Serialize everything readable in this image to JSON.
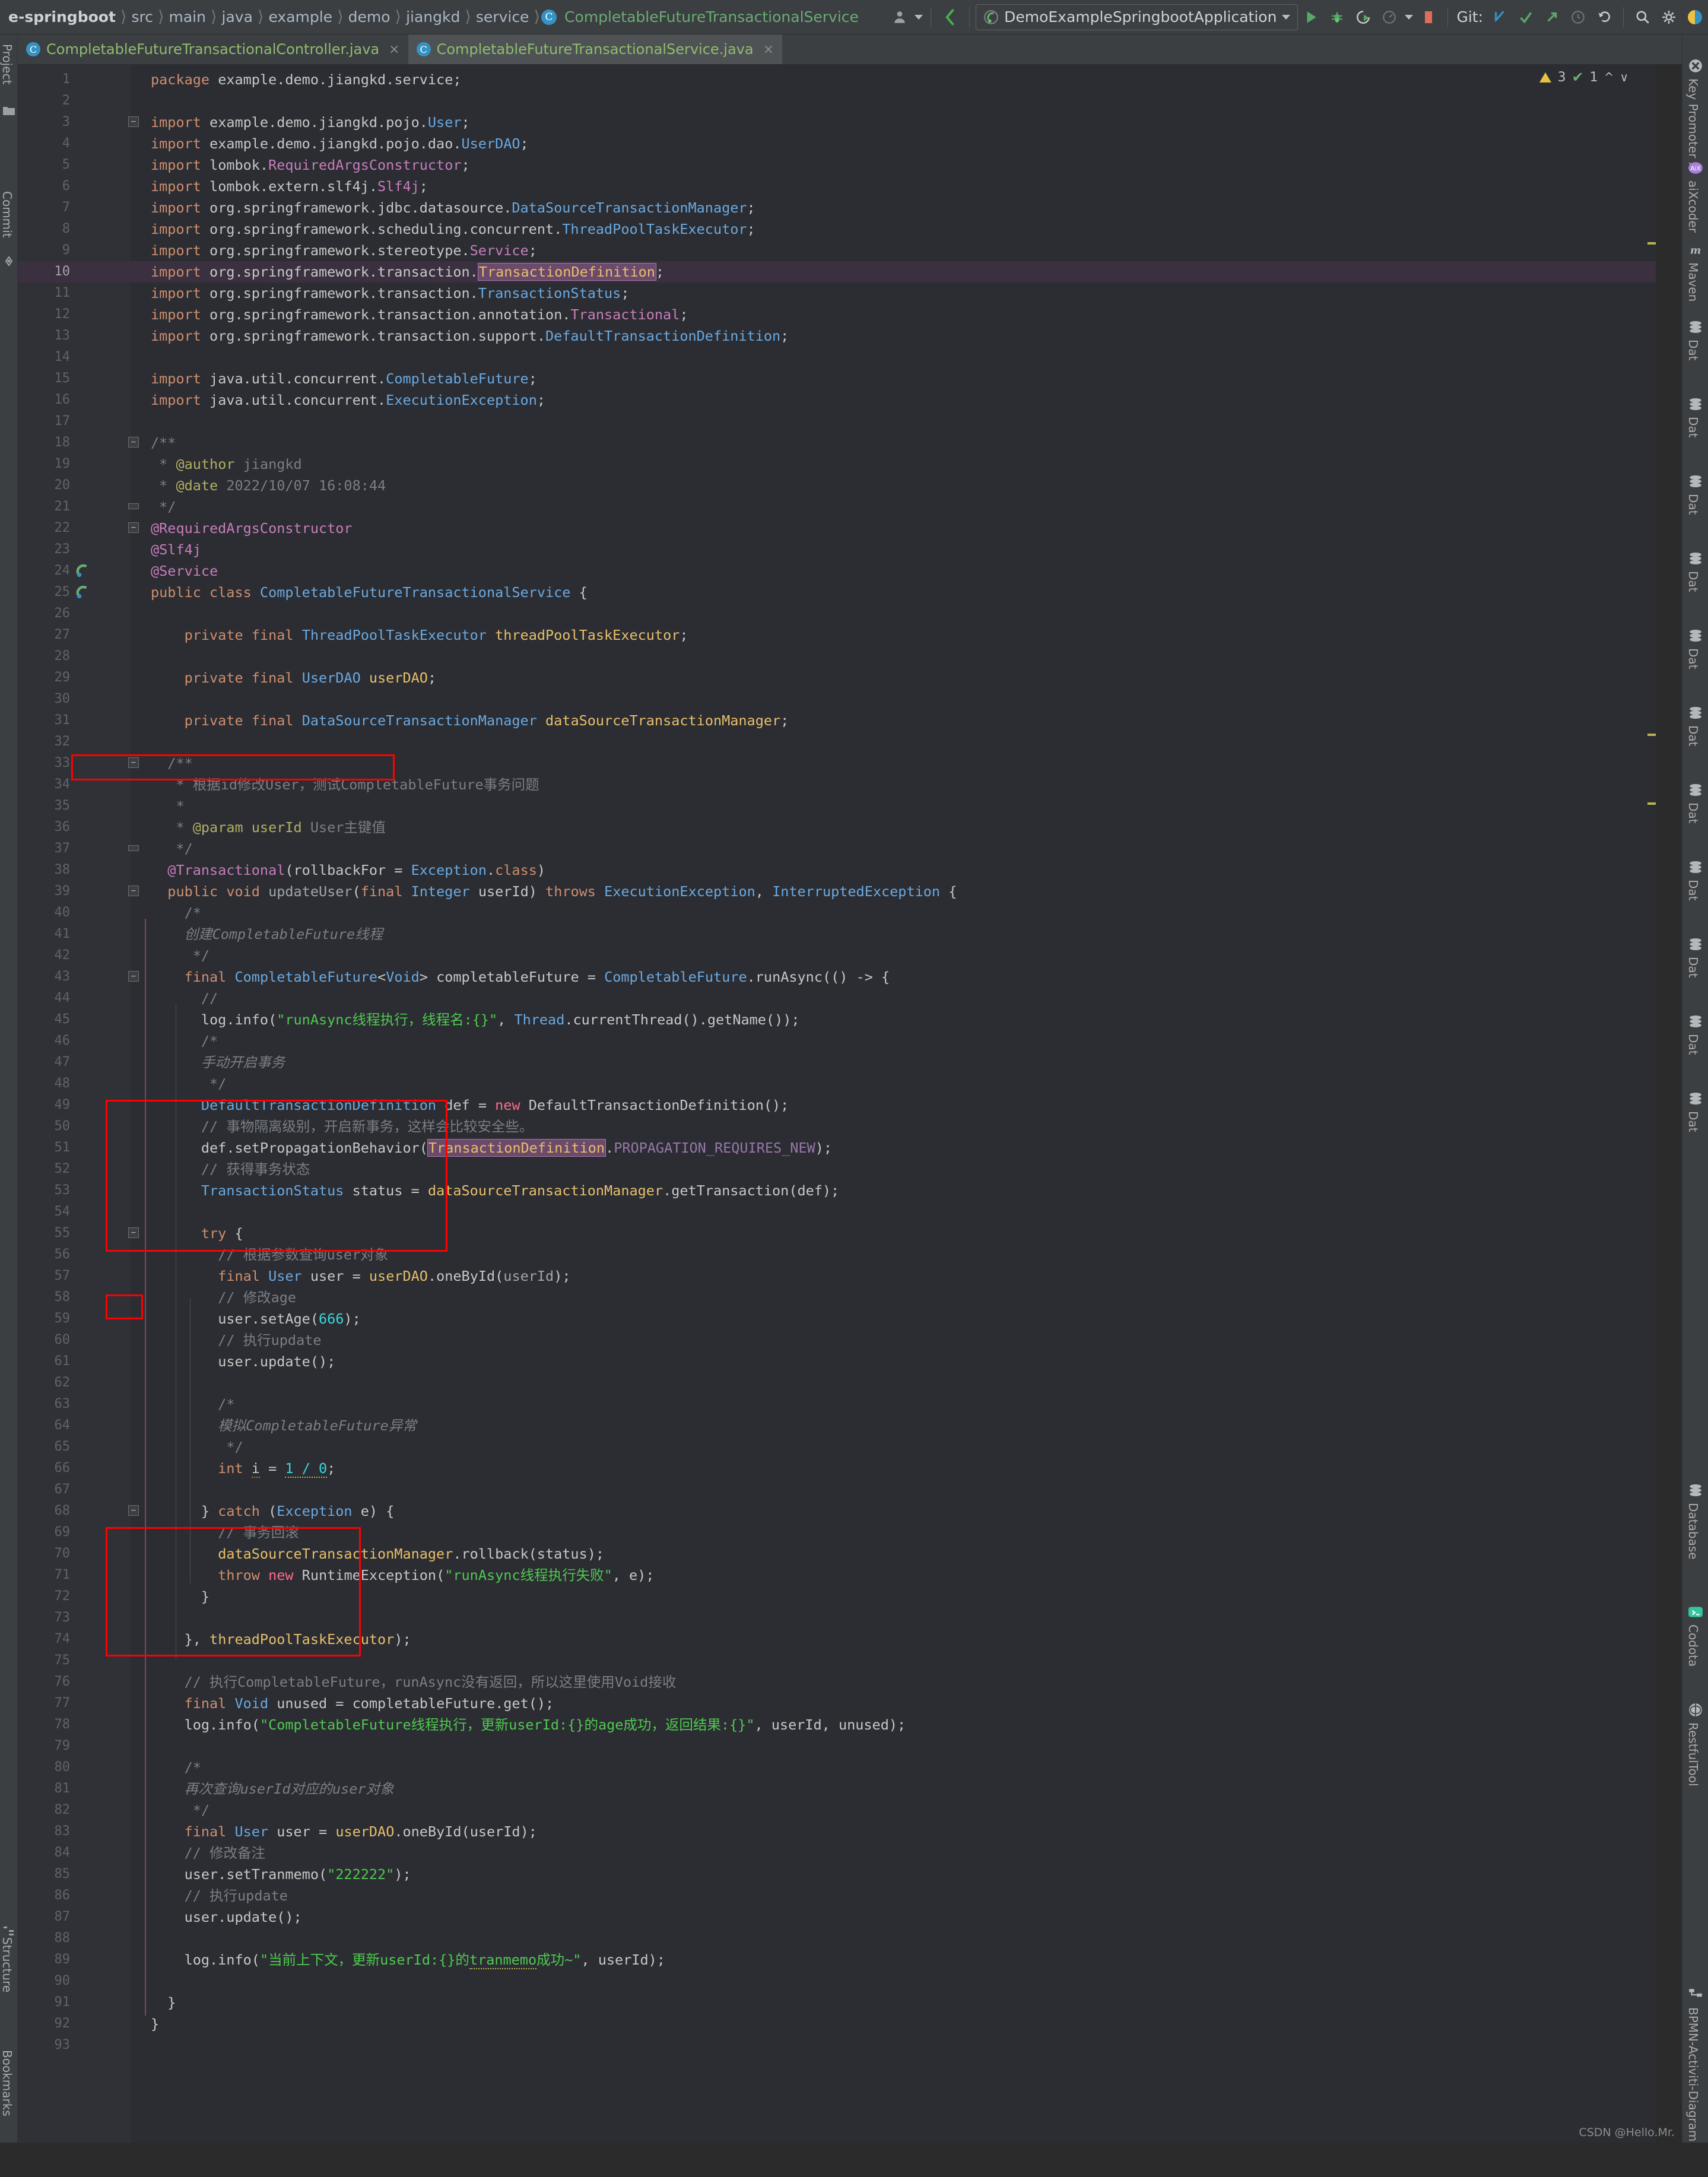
{
  "breadcrumb": {
    "items": [
      "e-springboot",
      "src",
      "main",
      "java",
      "example",
      "demo",
      "jiangkd",
      "service"
    ],
    "class_name": "CompletableFutureTransactionalService",
    "class_icon": "C"
  },
  "toolbar": {
    "avatar_icon": "user-icon",
    "back_icon": "back-arrow-icon",
    "run_config_name": "DemoExampleSpringbootApplication",
    "run_icon": "run-icon",
    "debug_icon": "debug-icon",
    "run_coverage_icon": "run-with-coverage-icon",
    "profile_icon": "profiler-icon",
    "stop_icon": "stop-icon",
    "git_label": "Git:",
    "git_update_icon": "update-project-icon",
    "git_commit_icon": "commit-icon",
    "git_push_icon": "push-icon",
    "git_history_icon": "history-icon",
    "git_rollback_icon": "rollback-icon",
    "search_icon": "search-everywhere-icon",
    "settings_icon": "gear-icon",
    "plugin_icon": "ide-plugin-icon"
  },
  "tabs": [
    {
      "label": "CompletableFutureTransactionalController.java",
      "icon": "C",
      "active": false,
      "close": "×"
    },
    {
      "label": "CompletableFutureTransactionalService.java",
      "icon": "C",
      "active": true,
      "close": "×"
    }
  ],
  "left_rail": [
    {
      "label": "Project",
      "icon": "project-icon"
    },
    {
      "label": "Commit",
      "icon": "commit-icon"
    },
    {
      "label": "Structure",
      "icon": "structure-icon"
    },
    {
      "label": "Bookmarks",
      "icon": "bookmarks-icon"
    }
  ],
  "right_rail": [
    {
      "label": "Key Promoter X",
      "icon": "key-promoter-icon"
    },
    {
      "label": "aiXcoder",
      "icon": "aixcoder-icon"
    },
    {
      "label": "Maven",
      "icon": "maven-icon"
    },
    {
      "label": "Dat",
      "icon": "database-icon"
    },
    {
      "label": "Dat",
      "icon": "database-icon"
    },
    {
      "label": "Dat",
      "icon": "database-icon"
    },
    {
      "label": "Dat",
      "icon": "database-icon"
    },
    {
      "label": "Dat",
      "icon": "database-icon"
    },
    {
      "label": "Dat",
      "icon": "database-icon"
    },
    {
      "label": "Dat",
      "icon": "database-icon"
    },
    {
      "label": "Dat",
      "icon": "database-icon"
    },
    {
      "label": "Dat",
      "icon": "database-icon"
    },
    {
      "label": "Dat",
      "icon": "database-icon"
    },
    {
      "label": "Dat",
      "icon": "database-icon"
    },
    {
      "label": "Database",
      "icon": "database-icon"
    },
    {
      "label": "Codota",
      "icon": "codota-icon"
    },
    {
      "label": "RestfulTool",
      "icon": "restfultool-icon"
    },
    {
      "label": "BPMN-Activiti-Diagram",
      "icon": "bpmn-icon"
    }
  ],
  "inspections": {
    "warning_count": "3",
    "weak_warning_count": "1",
    "warning_icon": "warning-triangle-icon",
    "weak_warning_icon": "weak-warning-icon",
    "up_icon": "chevron-up-icon",
    "down_icon": "chevron-down-icon",
    "more_icon": "more-vertical-icon"
  },
  "watermark": "CSDN @Hello.Mr.",
  "editor": {
    "file": "CompletableFutureTransactionalService.java",
    "total_lines": 93,
    "highlighted_line": 10,
    "highlighted_token": "TransactionDefinition",
    "lines": [
      {
        "n": 1,
        "html": "<span class='kw'>package</span> <span class='pln'>example.demo.jiangkd.service;</span>"
      },
      {
        "n": 2,
        "html": ""
      },
      {
        "n": 3,
        "html": "<span class='kw'>import</span> <span class='pln'>example.demo.jiangkd.pojo.</span><span class='typ'>User</span><span class='pln'>;</span>",
        "fold": "minus"
      },
      {
        "n": 4,
        "html": "<span class='kw'>import</span> <span class='pln'>example.demo.jiangkd.pojo.dao.</span><span class='typ'>UserDAO</span><span class='pln'>;</span>"
      },
      {
        "n": 5,
        "html": "<span class='kw'>import</span> <span class='pln'>lombok.</span><span class='annp'>RequiredArgsConstructor</span><span class='pln'>;</span>"
      },
      {
        "n": 6,
        "html": "<span class='kw'>import</span> <span class='pln'>lombok.extern.slf4j.</span><span class='annp'>Slf4j</span><span class='pln'>;</span>"
      },
      {
        "n": 7,
        "html": "<span class='kw'>import</span> <span class='pln'>org.springframework.jdbc.datasource.</span><span class='typ'>DataSourceTransactionManager</span><span class='pln'>;</span>"
      },
      {
        "n": 8,
        "html": "<span class='kw'>import</span> <span class='pln'>org.springframework.scheduling.concurrent.</span><span class='typ'>ThreadPoolTaskExecutor</span><span class='pln'>;</span>"
      },
      {
        "n": 9,
        "html": "<span class='kw'>import</span> <span class='pln'>org.springframework.stereotype.</span><span class='annp'>Service</span><span class='pln'>;</span>"
      },
      {
        "n": 10,
        "html": "<span class='kw'>import</span> <span class='pln'>org.springframework.transaction.</span><span class='hlid'>TransactionDefinition</span><span class='pln'>;</span>",
        "hl": true
      },
      {
        "n": 11,
        "html": "<span class='kw'>import</span> <span class='pln'>org.springframework.transaction.</span><span class='typ'>TransactionStatus</span><span class='pln'>;</span>"
      },
      {
        "n": 12,
        "html": "<span class='kw'>import</span> <span class='pln'>org.springframework.transaction.annotation.</span><span class='annp'>Transactional</span><span class='pln'>;</span>"
      },
      {
        "n": 13,
        "html": "<span class='kw'>import</span> <span class='pln'>org.springframework.transaction.support.</span><span class='typ'>DefaultTransactionDefinition</span><span class='pln'>;</span>"
      },
      {
        "n": 14,
        "html": ""
      },
      {
        "n": 15,
        "html": "<span class='kw'>import</span> <span class='pln'>java.util.concurrent.</span><span class='typ'>CompletableFuture</span><span class='pln'>;</span>"
      },
      {
        "n": 16,
        "html": "<span class='kw'>import</span> <span class='pln'>java.util.concurrent.</span><span class='typ'>ExecutionException</span><span class='pln'>;</span>"
      },
      {
        "n": 17,
        "html": ""
      },
      {
        "n": 18,
        "html": "<span class='cmt'>/**</span>",
        "fold": "minus"
      },
      {
        "n": 19,
        "html": " <span class='cmt'>* </span><span class='ann'>@author</span><span class='cmt'> jiangkd</span>"
      },
      {
        "n": 20,
        "html": " <span class='cmt'>* </span><span class='ann'>@date</span><span class='cmt'> 2022/10/07 16:08:44</span>"
      },
      {
        "n": 21,
        "html": " <span class='cmt'>*/</span>",
        "fold": "end"
      },
      {
        "n": 22,
        "html": "<span class='annp'>@RequiredArgsConstructor</span>",
        "fold": "minus"
      },
      {
        "n": 23,
        "html": "<span class='annp'>@Slf4j</span>"
      },
      {
        "n": 24,
        "html": "<span class='annp'>@Service</span>",
        "gutter": "spring-bean-icon"
      },
      {
        "n": 25,
        "html": "<span class='kw'>public class</span> <span class='typ'>CompletableFutureTransactionalService</span> <span class='pln'>{</span>",
        "gutter": "spring-bean-icon2"
      },
      {
        "n": 26,
        "html": ""
      },
      {
        "n": 27,
        "html": "    <span class='kw'>private final</span> <span class='typ'>ThreadPoolTaskExecutor</span> <span class='fld'>threadPoolTaskExecutor</span><span class='pln'>;</span>"
      },
      {
        "n": 28,
        "html": ""
      },
      {
        "n": 29,
        "html": "    <span class='kw'>private final</span> <span class='typ'>UserDAO</span> <span class='fld'>userDAO</span><span class='pln'>;</span>"
      },
      {
        "n": 30,
        "html": ""
      },
      {
        "n": 31,
        "html": "    <span class='kw'>private final</span> <span class='typ'>DataSourceTransactionManager</span> <span class='fld'>dataSourceTransactionManager</span><span class='pln'>;</span>"
      },
      {
        "n": 32,
        "html": ""
      },
      {
        "n": 33,
        "html": "  <span class='cmt'>/**</span>",
        "fold": "minus"
      },
      {
        "n": 34,
        "html": "   <span class='cmt'>* 根据id修改User，测试CompletableFuture事务问题</span>"
      },
      {
        "n": 35,
        "html": "   <span class='cmt'>*</span>"
      },
      {
        "n": 36,
        "html": "   <span class='cmt'>* </span><span class='ann'>@param</span><span class='ann'> userId</span><span class='cmt'> User主键值</span>"
      },
      {
        "n": 37,
        "html": "   <span class='cmt'>*/</span>",
        "fold": "end"
      },
      {
        "n": 38,
        "html": "  <span class='annp'>@Transactional</span><span class='pln'>(</span><span class='pln'>rollbackFor</span> <span class='pln'>=</span> <span class='typ'>Exception</span><span class='pln'>.</span><span class='kw'>class</span><span class='pln'>)</span>"
      },
      {
        "n": 39,
        "html": "  <span class='kw'>public void</span> <span class='param'>updateUser</span><span class='pln'>(</span><span class='kw'>final</span> <span class='typ'>Integer</span> <span class='pln'>userId</span><span class='pln'>)</span> <span class='kw'>throws</span> <span class='typ'>ExecutionException</span><span class='pln'>,</span> <span class='typ'>InterruptedException</span> <span class='pln'>{</span>",
        "fold": "minus"
      },
      {
        "n": 40,
        "html": "    <span class='cmt'>/*</span>"
      },
      {
        "n": 41,
        "html": "    <span class='cmt'><i>创建CompletableFuture线程</i></span>"
      },
      {
        "n": 42,
        "html": "     <span class='cmt'>*/</span>"
      },
      {
        "n": 43,
        "html": "    <span class='kw'>final</span> <span class='typ'>CompletableFuture</span><span class='pln'>&lt;</span><span class='typ'>Void</span><span class='pln'>&gt;</span> <span class='pln'>completableFuture</span> <span class='pln'>=</span> <span class='typ'>CompletableFuture</span><span class='pln'>.runAsync(() -&gt; {</span>",
        "fold": "minus"
      },
      {
        "n": 44,
        "html": "      <span class='cmt'>//</span>"
      },
      {
        "n": 45,
        "html": "      <span class='pln'>log.info(</span><span class='str'>\"runAsync线程执行，线程名:{}\"</span><span class='pln'>, </span><span class='typ'>Thread</span><span class='pln'>.currentThread().getName());</span>"
      },
      {
        "n": 46,
        "html": "      <span class='cmt'>/*</span>"
      },
      {
        "n": 47,
        "html": "      <span class='cmt'><i>手动开启事务</i></span>"
      },
      {
        "n": 48,
        "html": "       <span class='cmt'>*/</span>"
      },
      {
        "n": 49,
        "html": "      <span class='typ'>DefaultTransactionDefinition</span> <span class='pln'>def</span> <span class='pln'>=</span> <span class='kw2'>new</span> <span class='pln'>DefaultTransactionDefinition();</span>"
      },
      {
        "n": 50,
        "html": "      <span class='cmt'>// 事物隔离级别，开启新事务，这样会比较安全些。</span>"
      },
      {
        "n": 51,
        "html": "      <span class='pln'>def.setPropagationBehavior(</span><span class='hlid'>TransactionDefinition</span><span class='pln'>.</span><span class='stc'>PROPAGATION_REQUIRES_NEW</span><span class='pln'>);</span>"
      },
      {
        "n": 52,
        "html": "      <span class='cmt'>// 获得事务状态</span>"
      },
      {
        "n": 53,
        "html": "      <span class='typ'>TransactionStatus</span> <span class='pln'>status</span> <span class='pln'>=</span> <span class='fld'>dataSourceTransactionManager</span><span class='pln'>.getTransaction(def);</span>"
      },
      {
        "n": 54,
        "html": ""
      },
      {
        "n": 55,
        "html": "      <span class='kw'>try</span> <span class='pln'>{</span>",
        "fold": "minus"
      },
      {
        "n": 56,
        "html": "        <span class='cmt'>// 根据参数查询user对象</span>"
      },
      {
        "n": 57,
        "html": "        <span class='kw'>final</span> <span class='typ'>User</span> <span class='pln'>user</span> <span class='pln'>=</span> <span class='fld'>userDAO</span><span class='pln'>.oneById(</span><span class='param'>userId</span><span class='pln'>);</span>"
      },
      {
        "n": 58,
        "html": "        <span class='cmt'>// 修改age</span>"
      },
      {
        "n": 59,
        "html": "        <span class='pln'>user.setAge(</span><span class='num2'>666</span><span class='pln'>);</span>"
      },
      {
        "n": 60,
        "html": "        <span class='cmt'>// 执行update</span>"
      },
      {
        "n": 61,
        "html": "        <span class='pln'>user.update();</span>"
      },
      {
        "n": 62,
        "html": ""
      },
      {
        "n": 63,
        "html": "        <span class='cmt'>/*</span>"
      },
      {
        "n": 64,
        "html": "        <span class='cmt'><i>模拟CompletableFuture异常</i></span>"
      },
      {
        "n": 65,
        "html": "         <span class='cmt'>*/</span>"
      },
      {
        "n": 66,
        "html": "        <span class='kw'>int</span> <span class='pln wavy2'>i</span> <span class='pln'>=</span> <span class='num2 wavy'>1 / 0</span><span class='pln'>;</span>"
      },
      {
        "n": 67,
        "html": ""
      },
      {
        "n": 68,
        "html": "      <span class='pln'>} </span><span class='kw'>catch</span> <span class='pln'>(</span><span class='typ'>Exception</span> <span class='pln'>e) {</span>",
        "fold": "minus"
      },
      {
        "n": 69,
        "html": "        <span class='cmt'>// 事务回滚</span>"
      },
      {
        "n": 70,
        "html": "        <span class='fld'>dataSourceTransactionManager</span><span class='pln'>.rollback(status);</span>"
      },
      {
        "n": 71,
        "html": "        <span class='kw'>throw</span> <span class='kw2'>new</span> <span class='pln'>RuntimeException(</span><span class='str'>\"runAsync线程执行失败\"</span><span class='pln'>, e);</span>"
      },
      {
        "n": 72,
        "html": "      <span class='pln'>}</span>"
      },
      {
        "n": 73,
        "html": ""
      },
      {
        "n": 74,
        "html": "    <span class='pln'>}, </span><span class='fld'>threadPoolTaskExecutor</span><span class='pln'>);</span>"
      },
      {
        "n": 75,
        "html": ""
      },
      {
        "n": 76,
        "html": "    <span class='cmt'>// 执行CompletableFuture，runAsync没有返回，所以这里使用Void接收</span>"
      },
      {
        "n": 77,
        "html": "    <span class='kw'>final</span> <span class='typ'>Void</span> <span class='pln'>unused</span> <span class='pln'>=</span> <span class='pln'>completableFuture.get();</span>"
      },
      {
        "n": 78,
        "html": "    <span class='pln'>log.info(</span><span class='str'>\"CompletableFuture线程执行，更新userId:{}的age成功，返回结果:{}\"</span><span class='pln'>, userId, unused);</span>"
      },
      {
        "n": 79,
        "html": ""
      },
      {
        "n": 80,
        "html": "    <span class='cmt'>/*</span>"
      },
      {
        "n": 81,
        "html": "    <span class='cmt'><i>再次查询userId对应的user对象</i></span>"
      },
      {
        "n": 82,
        "html": "     <span class='cmt'>*/</span>"
      },
      {
        "n": 83,
        "html": "    <span class='kw'>final</span> <span class='typ'>User</span> <span class='pln'>user</span> <span class='pln'>=</span> <span class='fld'>userDAO</span><span class='pln'>.oneById(userId);</span>"
      },
      {
        "n": 84,
        "html": "    <span class='cmt'>// 修改备注</span>"
      },
      {
        "n": 85,
        "html": "    <span class='pln'>user.setTranmemo(</span><span class='str'>\"222222\"</span><span class='pln'>);</span>"
      },
      {
        "n": 86,
        "html": "    <span class='cmt'>// 执行update</span>"
      },
      {
        "n": 87,
        "html": "    <span class='pln'>user.update();</span>"
      },
      {
        "n": 88,
        "html": ""
      },
      {
        "n": 89,
        "html": "    <span class='pln'>log.info(</span><span class='str'>\"当前上下文，更新userId:{}的</span><span class='str wavy'>tranmemo</span><span class='str'>成功~\"</span><span class='pln'>, userId);</span>"
      },
      {
        "n": 90,
        "html": ""
      },
      {
        "n": 91,
        "html": "  <span class='pln'>}</span>"
      },
      {
        "n": 92,
        "html": "<span class='pln'>}</span>"
      },
      {
        "n": 93,
        "html": ""
      }
    ],
    "annotation_boxes": [
      {
        "name": "datasource-field-box",
        "line_from": 31,
        "line_to": 31
      },
      {
        "name": "manual-transaction-box",
        "line_from": 46,
        "line_to": 53
      },
      {
        "name": "try-keyword-box",
        "line_from": 55,
        "line_to": 55
      },
      {
        "name": "catch-block-box",
        "line_from": 68,
        "line_to": 72
      }
    ]
  }
}
